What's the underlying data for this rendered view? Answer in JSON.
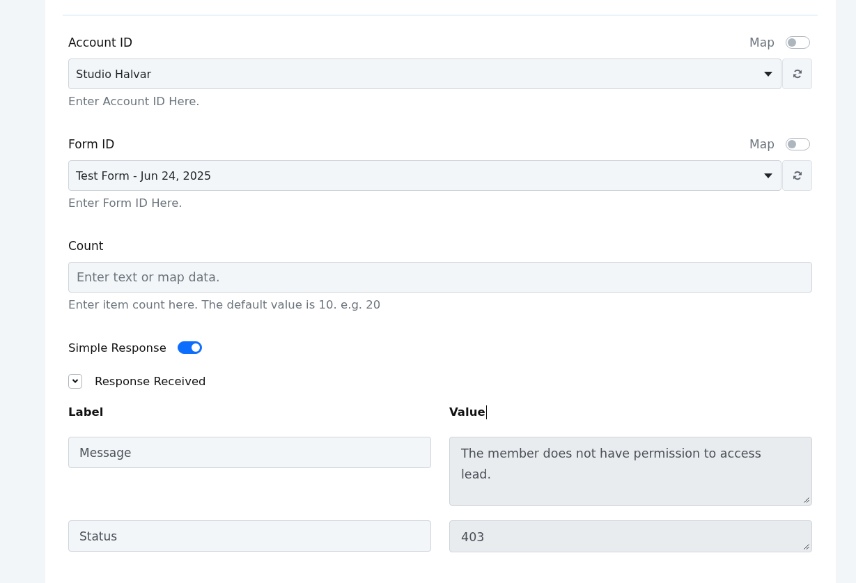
{
  "fields": [
    {
      "kind": "select",
      "label": "Account ID",
      "map": {
        "label": "Map",
        "on": false
      },
      "value": "Studio Halvar",
      "help": "Enter Account ID Here."
    },
    {
      "kind": "select",
      "label": "Form ID",
      "map": {
        "label": "Map",
        "on": false
      },
      "value": "Test Form - Jun 24, 2025",
      "help": "Enter Form ID Here."
    },
    {
      "kind": "text",
      "label": "Count",
      "placeholder": "Enter text or map data.",
      "help": "Enter item count here. The default value is 10. e.g. 20"
    }
  ],
  "simple_response": {
    "label": "Simple Response",
    "on": true
  },
  "response_section": {
    "title": "Response Received",
    "expanded": true,
    "columns": [
      "Label",
      "Value"
    ],
    "rows": [
      {
        "label": "Message",
        "value": "The member does not have permission to access lead."
      },
      {
        "label": "Status",
        "value": "403"
      }
    ]
  }
}
